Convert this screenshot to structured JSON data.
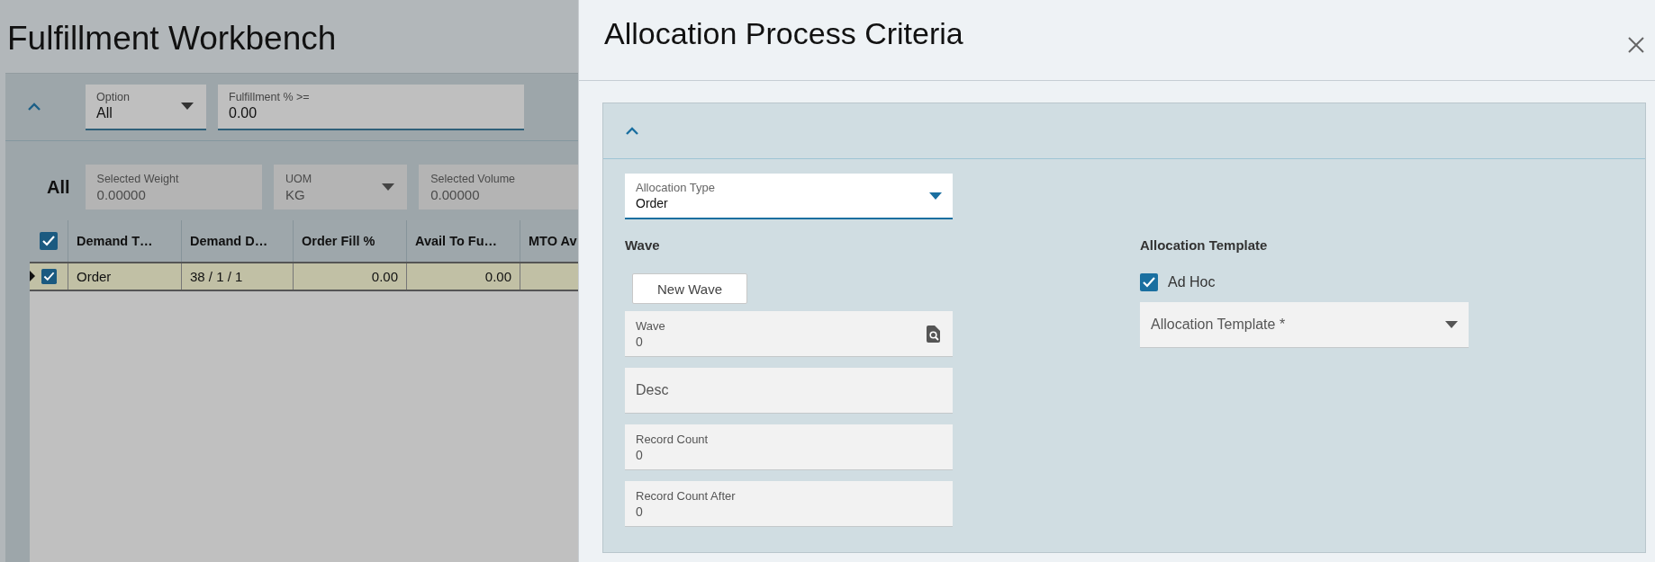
{
  "background_page": {
    "title": "Fulfillment Workbench",
    "filters": [
      {
        "kind": "dropdown",
        "label": "Option",
        "value": "All"
      },
      {
        "kind": "text",
        "label": "Fulfillment % >=",
        "value": "0.00"
      }
    ],
    "totals_label": "All",
    "totals": [
      {
        "kind": "text",
        "label": "Selected Weight",
        "value": "0.00000"
      },
      {
        "kind": "dropdown",
        "label": "UOM",
        "value": "KG"
      },
      {
        "kind": "text",
        "label": "Selected Volume",
        "value": "0.00000"
      }
    ],
    "table": {
      "header_checked": true,
      "columns": [
        "Demand T…",
        "Demand D…",
        "Order Fill %",
        "Avail To Fu…",
        "MTO Av"
      ],
      "rows": [
        {
          "checked": true,
          "selected": true,
          "cells": [
            "Order",
            "38 / 1 / 1",
            "0.00",
            "0.00"
          ]
        }
      ]
    }
  },
  "drawer": {
    "title": "Allocation Process Criteria",
    "allocation_type": {
      "label": "Allocation Type",
      "value": "Order"
    },
    "wave": {
      "heading": "Wave",
      "button": "New Wave",
      "fields": [
        {
          "kind": "lookup",
          "label": "Wave",
          "value": "0"
        },
        {
          "kind": "empty",
          "placeholder": "Desc"
        },
        {
          "kind": "text",
          "label": "Record Count",
          "value": "0"
        },
        {
          "kind": "text",
          "label": "Record Count After",
          "value": "0"
        }
      ]
    },
    "template": {
      "heading": "Allocation Template",
      "ad_hoc": {
        "label": "Ad Hoc",
        "checked": true
      },
      "dropdown": {
        "placeholder": "Allocation Template *"
      }
    }
  }
}
